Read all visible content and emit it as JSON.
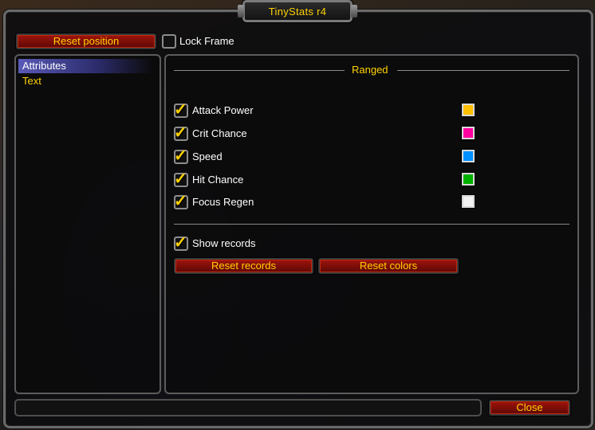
{
  "window": {
    "title": "TinyStats r4"
  },
  "toolbar": {
    "reset_position_label": "Reset position",
    "lock_frame_label": "Lock Frame",
    "lock_frame_checked": false
  },
  "sidebar": {
    "items": [
      {
        "label": "Attributes",
        "selected": true
      },
      {
        "label": "Text",
        "selected": false
      }
    ]
  },
  "main": {
    "section_title": "Ranged",
    "stats": [
      {
        "label": "Attack Power",
        "checked": true,
        "color": "#ffc000",
        "color_name": "gold"
      },
      {
        "label": "Crit Chance",
        "checked": true,
        "color": "#ff00a0",
        "color_name": "magenta"
      },
      {
        "label": "Speed",
        "checked": true,
        "color": "#0090ff",
        "color_name": "blue"
      },
      {
        "label": "Hit Chance",
        "checked": true,
        "color": "#00b000",
        "color_name": "green"
      },
      {
        "label": "Focus Regen",
        "checked": true,
        "color": "#f2f2f2",
        "color_name": "white"
      }
    ],
    "show_records_label": "Show records",
    "show_records_checked": true,
    "reset_records_label": "Reset records",
    "reset_colors_label": "Reset colors"
  },
  "footer": {
    "close_label": "Close",
    "input_value": ""
  },
  "colors": {
    "gold_text": "#ffd200",
    "button_red": "#8a0f08",
    "selected_highlight": "#4a4aa8"
  }
}
